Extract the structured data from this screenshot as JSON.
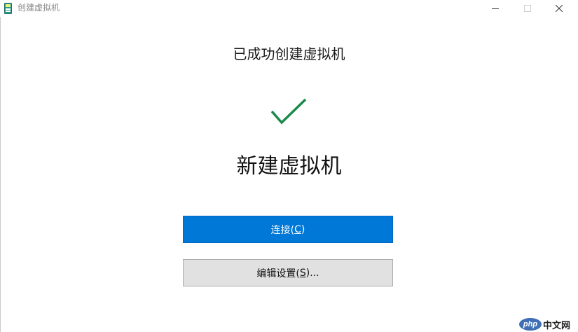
{
  "window": {
    "title": "创建虚拟机"
  },
  "main": {
    "heading": "已成功创建虚拟机",
    "status_icon": "checkmark-icon",
    "vm_name": "新建虚拟机"
  },
  "buttons": {
    "connect": {
      "label": "连接(",
      "accel": "C",
      "suffix": ")"
    },
    "edit_settings": {
      "label": "编辑设置(",
      "accel": "S",
      "suffix": ")..."
    }
  },
  "watermark": {
    "logo": "php",
    "text": "中文网"
  },
  "colors": {
    "accent": "#0078d7",
    "check": "#1a8a4a",
    "secondary_button": "#e1e1e1"
  }
}
